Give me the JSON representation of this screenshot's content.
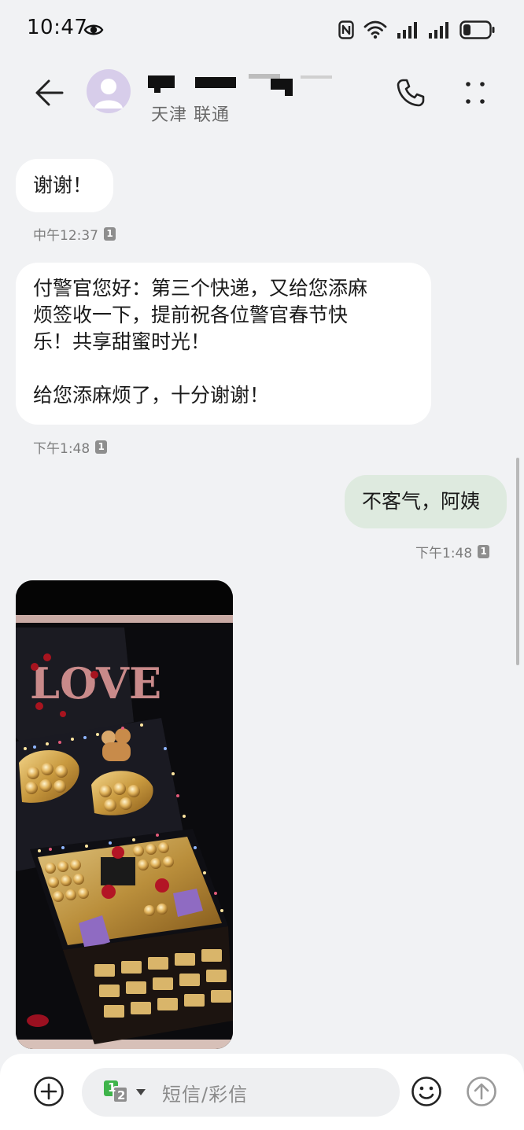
{
  "status_bar": {
    "time": "10:47",
    "icons": [
      "eye-icon",
      "nfc-icon",
      "wifi-icon",
      "signal-icon",
      "signal-icon",
      "battery-icon"
    ]
  },
  "header": {
    "back_icon": "arrow-left-icon",
    "contact_location": "天津 联通",
    "call_icon": "phone-icon",
    "more_icon": "more-vertical-icon"
  },
  "messages": [
    {
      "direction": "incoming",
      "lines": [
        "谢谢！"
      ],
      "time": "中午12:37",
      "sim": "1"
    },
    {
      "direction": "incoming",
      "lines": [
        "付警官您好：第三个快递，又给您添麻",
        "烦签收一下，提前祝各位警官春节快",
        "乐！共享甜蜜时光！",
        "",
        "给您添麻烦了，十分谢谢！"
      ],
      "time": "下午1:48",
      "sim": "1"
    },
    {
      "direction": "outgoing",
      "lines": [
        "不客气，阿姨"
      ],
      "time": "下午1:48",
      "sim": "1"
    },
    {
      "direction": "incoming",
      "type": "image",
      "image_text": "LOVE"
    }
  ],
  "composer": {
    "attach_icon": "plus-circle-icon",
    "sim_primary": "1",
    "sim_secondary": "2",
    "placeholder": "短信/彩信",
    "emoji_icon": "smiley-icon",
    "send_icon": "send-arrow-icon"
  },
  "colors": {
    "background": "#f1f2f4",
    "incoming_bubble": "#ffffff",
    "outgoing_bubble": "#deeadf",
    "sim_green": "#3fb44b"
  }
}
